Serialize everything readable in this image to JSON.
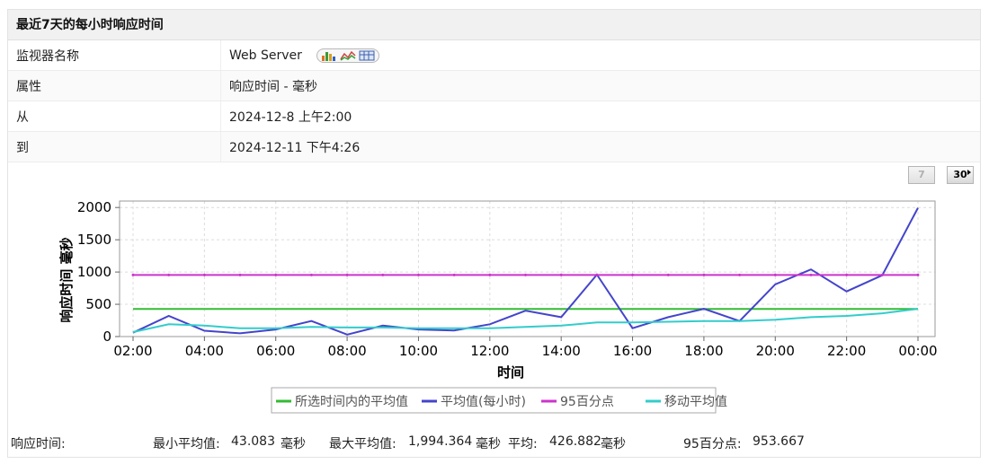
{
  "panel": {
    "title": "最近7天的每小时响应时间"
  },
  "info": [
    {
      "label": "监视器名称",
      "value": "Web Server"
    },
    {
      "label": "属性",
      "value": "响应时间 - 毫秒"
    },
    {
      "label": "从",
      "value": "2024-12-8 上午2:00"
    },
    {
      "label": "到",
      "value": "2024-12-11 下午4:26"
    }
  ],
  "icons": [
    "bar-chart-icon",
    "line-chart-icon",
    "table-icon"
  ],
  "range_buttons": {
    "seven": "7",
    "thirty": "30"
  },
  "colors": {
    "period_avg": "#33bb33",
    "hourly_avg": "#4444cc",
    "p95": "#cc33cc",
    "moving_avg": "#33cccc"
  },
  "chart_data": {
    "type": "line",
    "x": [
      "02:00",
      "03:00",
      "04:00",
      "05:00",
      "06:00",
      "07:00",
      "08:00",
      "09:00",
      "10:00",
      "11:00",
      "12:00",
      "13:00",
      "14:00",
      "15:00",
      "16:00",
      "17:00",
      "18:00",
      "19:00",
      "20:00",
      "21:00",
      "22:00",
      "23:00",
      "00:00"
    ],
    "x_tick_labels": [
      "02:00",
      "04:00",
      "06:00",
      "08:00",
      "10:00",
      "12:00",
      "14:00",
      "16:00",
      "18:00",
      "20:00",
      "22:00",
      "00:00"
    ],
    "y_ticks": [
      "0",
      "500",
      "1000",
      "1500",
      "2000"
    ],
    "xlabel": "时间",
    "ylabel": "响应时间 毫秒",
    "ylim": [
      0,
      2100
    ],
    "grid": true,
    "legend_position": "bottom",
    "series": [
      {
        "name": "所选时间内的平均值",
        "color_key": "period_avg",
        "values": [
          427,
          427,
          427,
          427,
          427,
          427,
          427,
          427,
          427,
          427,
          427,
          427,
          427,
          427,
          427,
          427,
          427,
          427,
          427,
          427,
          427,
          427,
          427
        ]
      },
      {
        "name": "平均值(每小时)",
        "color_key": "hourly_avg",
        "values": [
          60,
          320,
          90,
          50,
          110,
          240,
          30,
          170,
          110,
          95,
          190,
          400,
          300,
          960,
          130,
          300,
          430,
          240,
          810,
          1040,
          700,
          950,
          1994
        ]
      },
      {
        "name": "95百分点",
        "color_key": "p95",
        "values": [
          954,
          954,
          954,
          954,
          954,
          954,
          954,
          954,
          954,
          954,
          954,
          954,
          954,
          954,
          954,
          954,
          954,
          954,
          954,
          954,
          954,
          954,
          954
        ]
      },
      {
        "name": "移动平均值",
        "color_key": "moving_avg",
        "values": [
          70,
          190,
          170,
          130,
          130,
          150,
          140,
          140,
          130,
          130,
          130,
          150,
          170,
          220,
          220,
          230,
          240,
          240,
          260,
          300,
          320,
          360,
          430
        ]
      }
    ]
  },
  "summary": {
    "label": "响应时间:",
    "min_label": "最小平均值:",
    "min_value": "43.083",
    "unit": "毫秒",
    "max_label": "最大平均值:",
    "max_value": "1,994.364",
    "avg_label": "平均:",
    "avg_value": "426.882",
    "p95_label": "95百分点:",
    "p95_value": "953.667"
  }
}
